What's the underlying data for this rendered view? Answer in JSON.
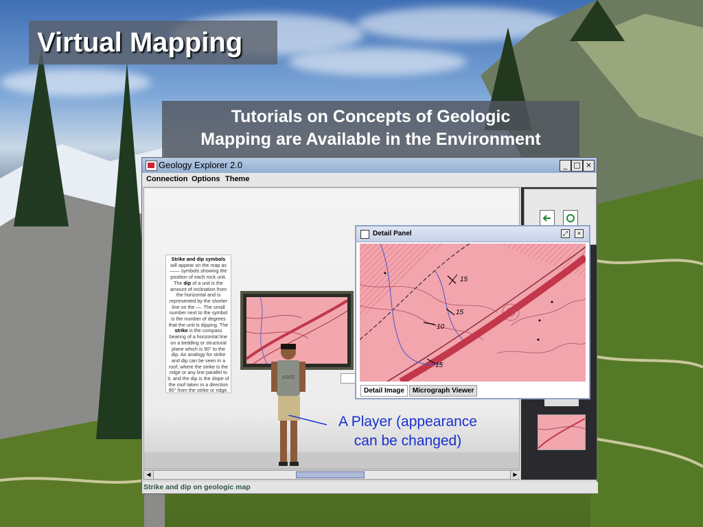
{
  "slide": {
    "title": "Virtual Mapping",
    "subtitle_line1": "Tutorials on Concepts of Geologic",
    "subtitle_line2": "Mapping are Available in the Environment",
    "callout_line1": "A Player (appearance",
    "callout_line2": "can be changed)"
  },
  "window": {
    "title": "Geology Explorer 2.0",
    "buttons": {
      "minimize": "_",
      "maximize": "□",
      "close": "×"
    },
    "menu": [
      "Connection",
      "Options",
      "Theme"
    ],
    "status": "Strike and dip on geologic map"
  },
  "info_panel": {
    "strike_dip_heading": "Strike and dip symbols",
    "text_1": "will appear on the map as",
    "text_2": "symbols showing the position of each rock unit. The",
    "dip_word": "dip",
    "text_3": "of a unit is the amount of inclination from the horizontal and is represented by the shorter line on the",
    "text_4": ". The small number next to the symbol is the number of degrees that the unit is dipping. The",
    "strike_word": "strike",
    "text_5": "is the compass bearing of a horizontal line on a bedding or structural plane which is 90° to the dip. An analogy for strike and dip can be seen in a roof, where the strike is the ridge or any line parallel to it, and the dip is the slope of the roof taken in a direction 90° from the strike or ridge."
  },
  "detail_panel": {
    "title": "Detail Panel",
    "tabs": [
      "Detail Image",
      "Micrograph Viewer"
    ],
    "map_labels": [
      "15",
      "15",
      "10",
      "15"
    ]
  },
  "colors": {
    "map_pink": "#f2a5ad",
    "map_line": "#c2374a",
    "callout": "#1830d0"
  }
}
